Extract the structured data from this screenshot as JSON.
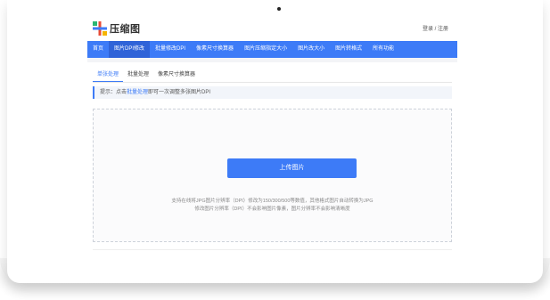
{
  "header": {
    "logo_text": "压缩图",
    "login": "登录",
    "sep": "/",
    "register": "注册"
  },
  "nav": {
    "items": [
      {
        "label": "首页",
        "active": false
      },
      {
        "label": "图片DPI修改",
        "active": true
      },
      {
        "label": "批量修改DPI",
        "active": false
      },
      {
        "label": "像素尺寸换算器",
        "active": false
      },
      {
        "label": "图片压缩指定大小",
        "active": false
      },
      {
        "label": "图片改大小",
        "active": false
      },
      {
        "label": "图片转格式",
        "active": false
      },
      {
        "label": "所有功能",
        "active": false
      }
    ]
  },
  "subtabs": [
    {
      "label": "单张处理",
      "active": true
    },
    {
      "label": "批量处理",
      "active": false
    },
    {
      "label": "像素尺寸换算器",
      "active": false
    }
  ],
  "tip": {
    "prefix": "提示：点击",
    "link": "批量处理",
    "suffix": "即可一次调整多张图片DPI"
  },
  "upload": {
    "button_label": "上传图片",
    "desc_line1": "支持在线将JPG图片分辨率（DPI）修改为150/300/500等数值，其他格式图片自动转换为JPG",
    "desc_line2": "修改图片分辨率（DPI）不会影响图片像素，图片分辨率不会影响清晰度"
  },
  "colors": {
    "primary": "#3d7bf7",
    "nav_active": "#2f63d8",
    "logo_red": "#e94b35",
    "logo_blue": "#3d7bf7",
    "logo_green": "#2bb673",
    "logo_yellow": "#f5b400"
  }
}
